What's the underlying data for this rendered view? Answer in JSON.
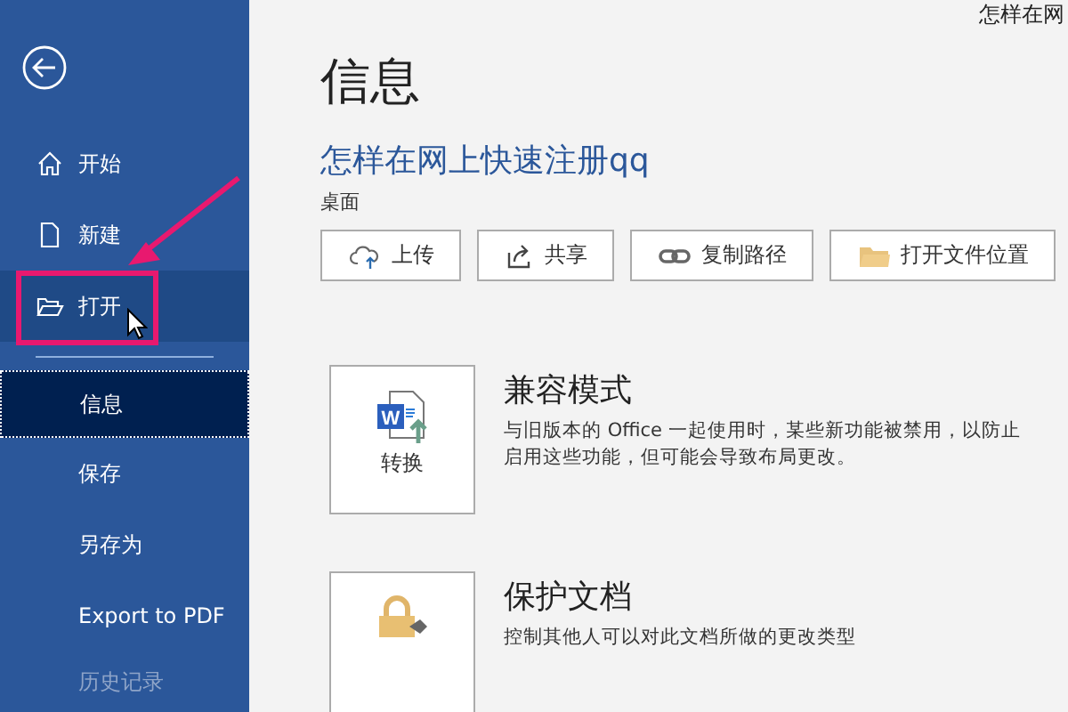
{
  "window": {
    "title": "怎样在网"
  },
  "sidebar": {
    "items": [
      {
        "kind": "home",
        "label": "开始",
        "selected": false,
        "highlighted": false,
        "disabled": false
      },
      {
        "kind": "new",
        "label": "新建",
        "selected": false,
        "highlighted": false,
        "disabled": false
      },
      {
        "kind": "open",
        "label": "打开",
        "selected": false,
        "highlighted": true,
        "disabled": false
      },
      {
        "kind": "divider"
      },
      {
        "kind": "plain",
        "label": "信息",
        "selected": true,
        "highlighted": false,
        "disabled": false
      },
      {
        "kind": "plain",
        "label": "保存",
        "selected": false,
        "highlighted": false,
        "disabled": false
      },
      {
        "kind": "plain",
        "label": "另存为",
        "selected": false,
        "highlighted": false,
        "disabled": false
      },
      {
        "kind": "plain",
        "label": "Export to PDF",
        "selected": false,
        "highlighted": false,
        "disabled": false
      },
      {
        "kind": "plain",
        "label": "历史记录",
        "selected": false,
        "highlighted": false,
        "disabled": true
      }
    ]
  },
  "page": {
    "title": "信息",
    "document_name": "怎样在网上快速注册qq",
    "location": "桌面",
    "actions": [
      {
        "kind": "upload",
        "label": "上传"
      },
      {
        "kind": "share",
        "label": "共享"
      },
      {
        "kind": "link",
        "label": "复制路径"
      },
      {
        "kind": "location",
        "label": "打开文件位置"
      }
    ],
    "sections": [
      {
        "kind": "convert",
        "icon_letter": "W",
        "button_label": "转换",
        "heading": "兼容模式",
        "description": "与旧版本的 Office 一起使用时，某些新功能被禁用，以防止",
        "description_2": "启用这些功能，但可能会导致布局更改。"
      },
      {
        "kind": "protect",
        "heading": "保护文档",
        "description": "控制其他人可以对此文档所做的更改类型"
      }
    ]
  }
}
